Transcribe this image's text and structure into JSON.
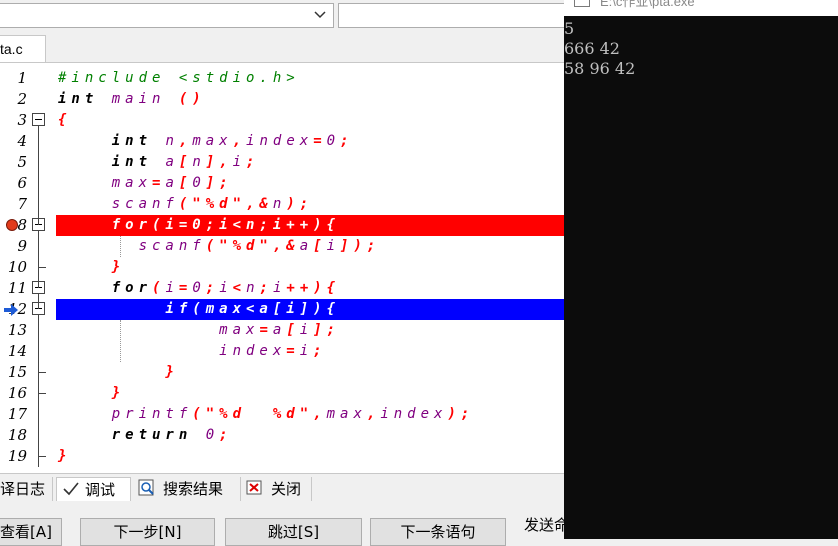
{
  "toolbar": {
    "combo_value": "",
    "combo2_value": ""
  },
  "editor": {
    "file_tab": "ta.c",
    "line_numbers": [
      "1",
      "2",
      "3",
      "4",
      "5",
      "6",
      "7",
      "8",
      "9",
      "10",
      "11",
      "12",
      "13",
      "14",
      "15",
      "16",
      "17",
      "18",
      "19"
    ],
    "lines": [
      [
        {
          "t": "#include <stdio.h>",
          "c": "pp"
        }
      ],
      [
        {
          "t": "int",
          "c": "kw"
        },
        {
          "t": " main ",
          "c": "pu"
        },
        {
          "t": "()",
          "c": "rd"
        }
      ],
      [
        {
          "t": "{",
          "c": "rd"
        }
      ],
      [
        {
          "t": "    int",
          "c": "kw"
        },
        {
          "t": " n",
          "c": "pu"
        },
        {
          "t": ",",
          "c": "rd"
        },
        {
          "t": "max",
          "c": "pu"
        },
        {
          "t": ",",
          "c": "rd"
        },
        {
          "t": "index",
          "c": "pu"
        },
        {
          "t": "=",
          "c": "rd"
        },
        {
          "t": "0",
          "c": "pu"
        },
        {
          "t": ";",
          "c": "rd"
        }
      ],
      [
        {
          "t": "    int",
          "c": "kw"
        },
        {
          "t": " a",
          "c": "pu"
        },
        {
          "t": "[",
          "c": "rd"
        },
        {
          "t": "n",
          "c": "pu"
        },
        {
          "t": "],",
          "c": "rd"
        },
        {
          "t": "i",
          "c": "pu"
        },
        {
          "t": ";",
          "c": "rd"
        }
      ],
      [
        {
          "t": "    max",
          "c": "pu"
        },
        {
          "t": "=",
          "c": "rd"
        },
        {
          "t": "a",
          "c": "pu"
        },
        {
          "t": "[",
          "c": "rd"
        },
        {
          "t": "0",
          "c": "pu"
        },
        {
          "t": "];",
          "c": "rd"
        }
      ],
      [
        {
          "t": "    scanf",
          "c": "pu"
        },
        {
          "t": "(\"%d\",&",
          "c": "rd"
        },
        {
          "t": "n",
          "c": "pu"
        },
        {
          "t": ");",
          "c": "rd"
        }
      ],
      [
        {
          "t": "    for(i=0;i<n;i++){",
          "c": "wt"
        }
      ],
      [
        {
          "t": "      scanf",
          "c": "pu"
        },
        {
          "t": "(\"%d\",&",
          "c": "rd"
        },
        {
          "t": "a",
          "c": "pu"
        },
        {
          "t": "[",
          "c": "rd"
        },
        {
          "t": "i",
          "c": "pu"
        },
        {
          "t": "]);",
          "c": "rd"
        }
      ],
      [
        {
          "t": "    }",
          "c": "rd"
        }
      ],
      [
        {
          "t": "    for",
          "c": "kw"
        },
        {
          "t": "(",
          "c": "rd"
        },
        {
          "t": "i",
          "c": "pu"
        },
        {
          "t": "=",
          "c": "rd"
        },
        {
          "t": "0",
          "c": "pu"
        },
        {
          "t": ";",
          "c": "rd"
        },
        {
          "t": "i",
          "c": "pu"
        },
        {
          "t": "<",
          "c": "rd"
        },
        {
          "t": "n",
          "c": "pu"
        },
        {
          "t": ";",
          "c": "rd"
        },
        {
          "t": "i",
          "c": "pu"
        },
        {
          "t": "++){",
          "c": "rd"
        }
      ],
      [
        {
          "t": "        if(max<a[i]){",
          "c": "wt"
        }
      ],
      [
        {
          "t": "            max",
          "c": "pu"
        },
        {
          "t": "=",
          "c": "rd"
        },
        {
          "t": "a",
          "c": "pu"
        },
        {
          "t": "[",
          "c": "rd"
        },
        {
          "t": "i",
          "c": "pu"
        },
        {
          "t": "];",
          "c": "rd"
        }
      ],
      [
        {
          "t": "            index",
          "c": "pu"
        },
        {
          "t": "=",
          "c": "rd"
        },
        {
          "t": "i",
          "c": "pu"
        },
        {
          "t": ";",
          "c": "rd"
        }
      ],
      [
        {
          "t": "        }",
          "c": "rd"
        }
      ],
      [
        {
          "t": "    }",
          "c": "rd"
        }
      ],
      [
        {
          "t": "    printf",
          "c": "pu"
        },
        {
          "t": "(\"%d  %d\",",
          "c": "rd"
        },
        {
          "t": "max",
          "c": "pu"
        },
        {
          "t": ",",
          "c": "rd"
        },
        {
          "t": "index",
          "c": "pu"
        },
        {
          "t": ");",
          "c": "rd"
        }
      ],
      [
        {
          "t": "    return",
          "c": "kw"
        },
        {
          "t": " 0",
          "c": "pu"
        },
        {
          "t": ";",
          "c": "rd"
        }
      ],
      [
        {
          "t": "}",
          "c": "rd"
        }
      ]
    ],
    "breakpoint_color": "#ff0000",
    "current_line_color": "#0000ff"
  },
  "bottom_tabs": {
    "compile_log": "译日志",
    "debug": "调试",
    "search_results": "搜索结果",
    "close": "关闭"
  },
  "debug_buttons": {
    "view": "查看[A]",
    "next_step": "下一步[N]",
    "skip": "跳过[S]",
    "next_statement": "下一条语句",
    "send_command": "发送命"
  },
  "console": {
    "title": "E:\\c作业\\pta.exe",
    "output": [
      "5",
      "666 42",
      "58 96 42"
    ]
  }
}
